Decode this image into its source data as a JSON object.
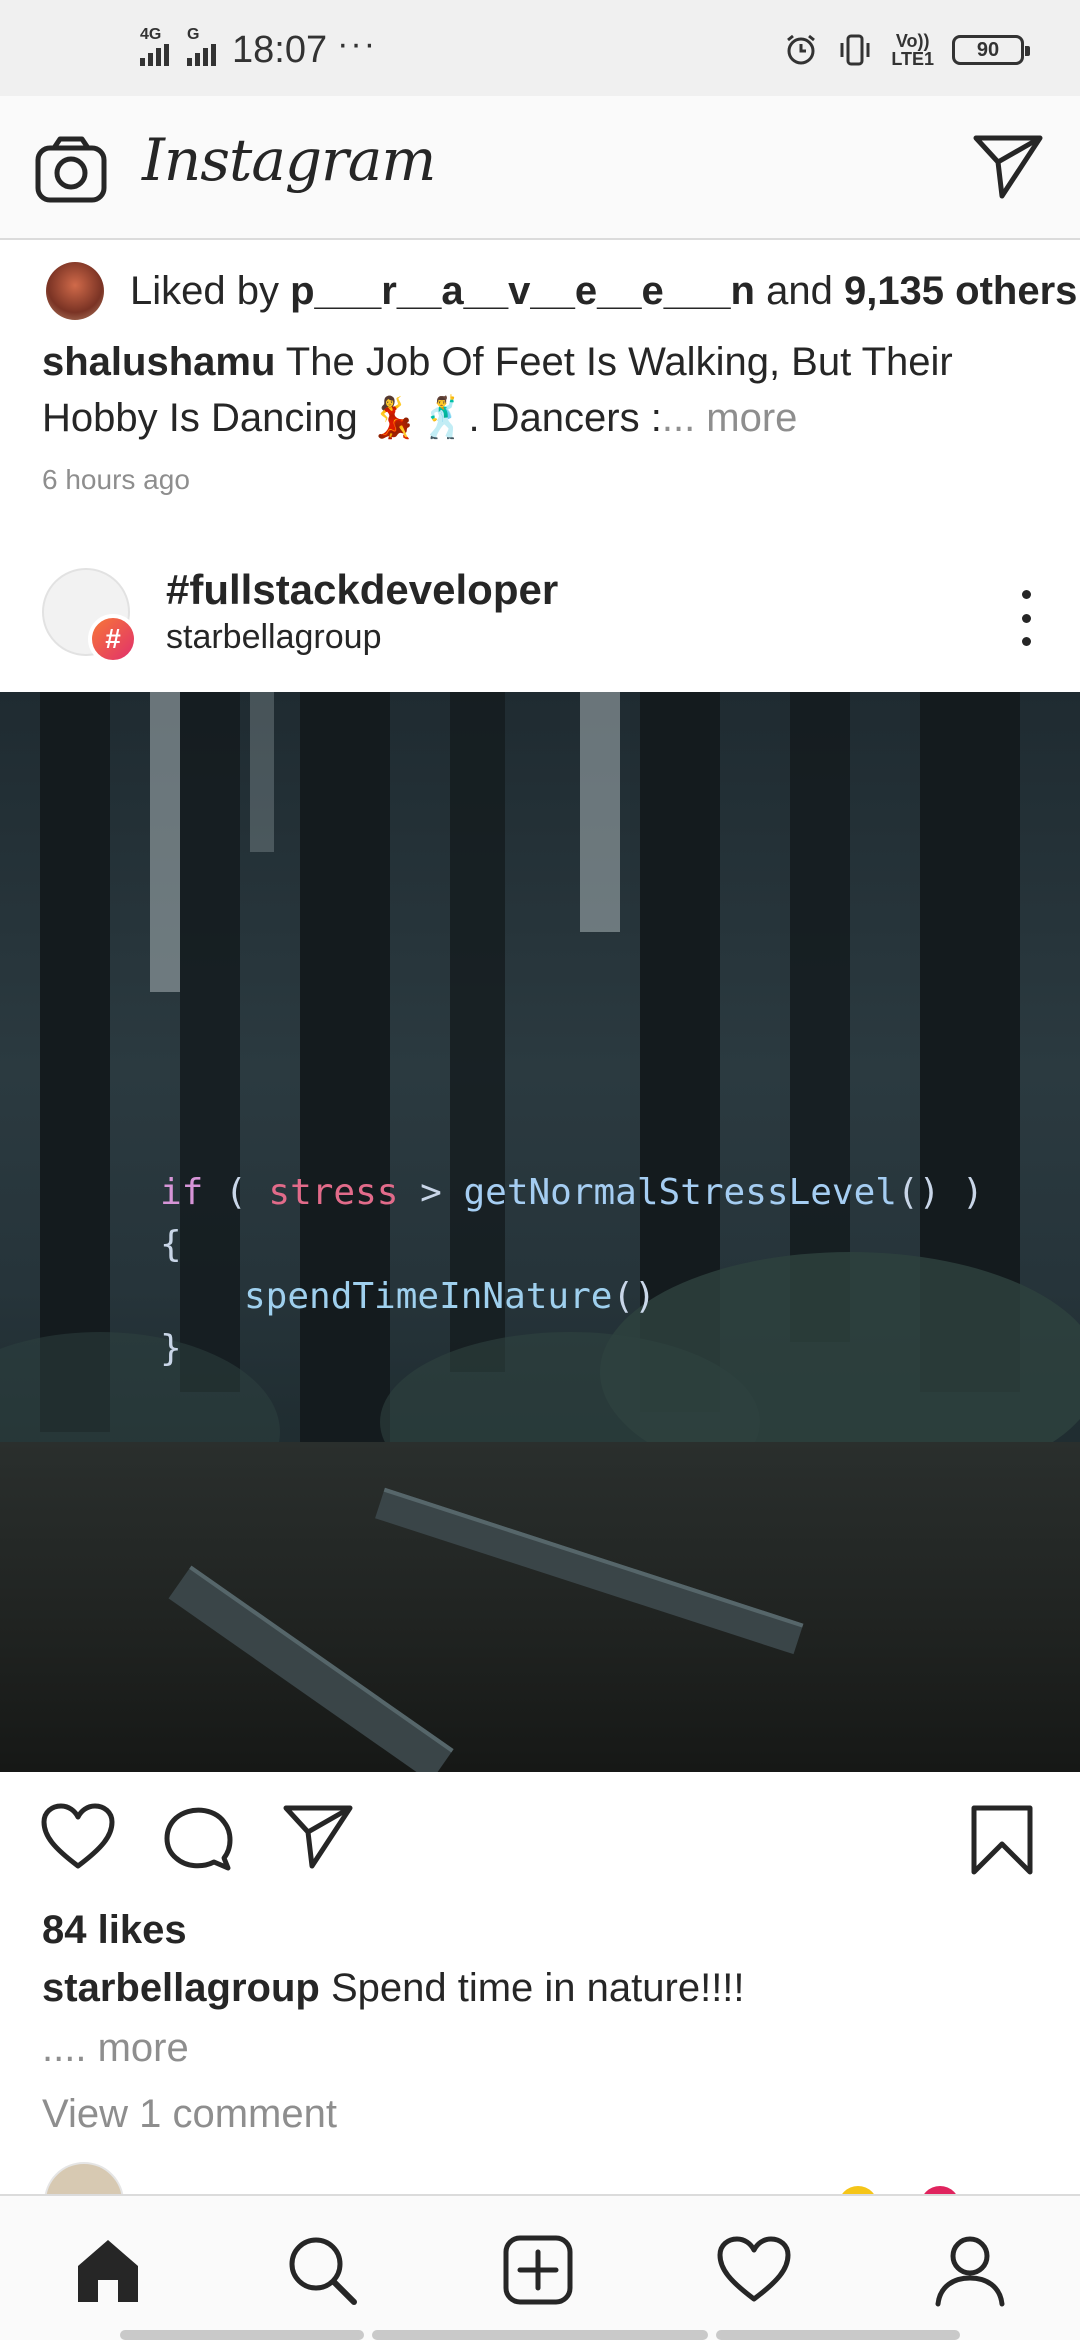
{
  "status_bar": {
    "net1": "4G",
    "net2": "G",
    "time": "18:07",
    "dots": "···",
    "volte_top": "Vo))",
    "volte_bottom": "LTE1",
    "battery": "90"
  },
  "header": {
    "logo": "Instagram",
    "camera_icon": "camera-icon",
    "direct_icon": "paper-plane-icon"
  },
  "previous_post": {
    "liked_by_prefix": "Liked by ",
    "liked_by_user": "p___r__a__v__e__e___n",
    "liked_by_and": " and ",
    "liked_by_others": "9,135 others",
    "caption_user": "shalushamu",
    "caption_text": " The Job Of Feet Is Walking, But Their Hobby Is Dancing 💃🕺. Dancers :",
    "caption_more": "... more",
    "time_ago": "6 hours ago"
  },
  "post": {
    "title": "#fullstackdeveloper",
    "account": "starbellagroup",
    "badge": "#",
    "code": {
      "line1_if": "if",
      "line1_open": " ( ",
      "line1_var": "stress",
      "line1_op": " > ",
      "line1_fn": "getNormalStressLevel",
      "line1_close": "() )",
      "line2": "{",
      "line3_fn": "spendTimeInNature",
      "line3_paren": "()",
      "line4": "}"
    },
    "likes": "84 likes",
    "caption_user": "starbellagroup",
    "caption_text": " Spend time in nature!!!!",
    "caption_more": ".... more",
    "view_comments": "View 1 comment"
  },
  "icons": {
    "like": "heart-icon",
    "comment": "comment-icon",
    "share": "paper-plane-icon",
    "save": "bookmark-icon"
  },
  "colors": {
    "primary_text": "#262626",
    "muted_text": "#8e8e8e",
    "border": "#dbdbdb",
    "badge_start": "#f77737",
    "badge_end": "#e1306c"
  },
  "bottom_nav": [
    "home-icon",
    "search-icon",
    "add-post-icon",
    "activity-heart-icon",
    "profile-icon"
  ]
}
